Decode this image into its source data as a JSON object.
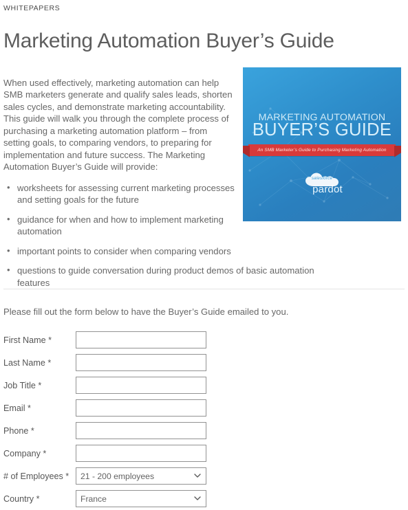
{
  "header": {
    "eyebrow": "WHITEPAPERS",
    "title": "Marketing Automation Buyer’s Guide"
  },
  "content": {
    "intro": "When used effectively, marketing automation can help SMB marketers generate and qualify sales leads, shorten sales cycles, and demonstrate marketing accountability. This guide will walk you through the complete process of purchasing a marketing automation platform – from setting goals, to comparing vendors, to preparing for implementation and future success. The Marketing Automation Buyer’s Guide will provide:",
    "bullets": [
      "worksheets for assessing current marketing processes and setting goals for the future",
      "guidance for when and how to implement marketing automation",
      "important points to consider when comparing vendors",
      "questions to guide conversation during product demos of basic automation features"
    ]
  },
  "cover": {
    "title_line1": "MARKETING AUTOMATION",
    "title_line2": "BUYER’S GUIDE",
    "ribbon_text": "An SMB Marketer’s Guide to Purchasing Marketing Automation",
    "logo_salesforce": "salesforce",
    "logo_pardot": "pardot",
    "background_color": "#2e8ecb",
    "ribbon_color": "#d83a3a"
  },
  "form": {
    "lead_text": "Please fill out the form below to have the Buyer’s Guide emailed to you.",
    "fields": [
      {
        "label": "First Name *",
        "type": "text",
        "value": "",
        "placeholder": ""
      },
      {
        "label": "Last Name *",
        "type": "text",
        "value": "",
        "placeholder": ""
      },
      {
        "label": "Job Title *",
        "type": "text",
        "value": "",
        "placeholder": ""
      },
      {
        "label": "Email *",
        "type": "text",
        "value": "",
        "placeholder": ""
      },
      {
        "label": "Phone *",
        "type": "text",
        "value": "",
        "placeholder": ""
      },
      {
        "label": "Company *",
        "type": "text",
        "value": "",
        "placeholder": ""
      },
      {
        "label": "# of Employees *",
        "type": "select",
        "value": "21 - 200 employees",
        "placeholder": ""
      },
      {
        "label": "Country *",
        "type": "select",
        "value": "France",
        "placeholder": ""
      }
    ]
  }
}
